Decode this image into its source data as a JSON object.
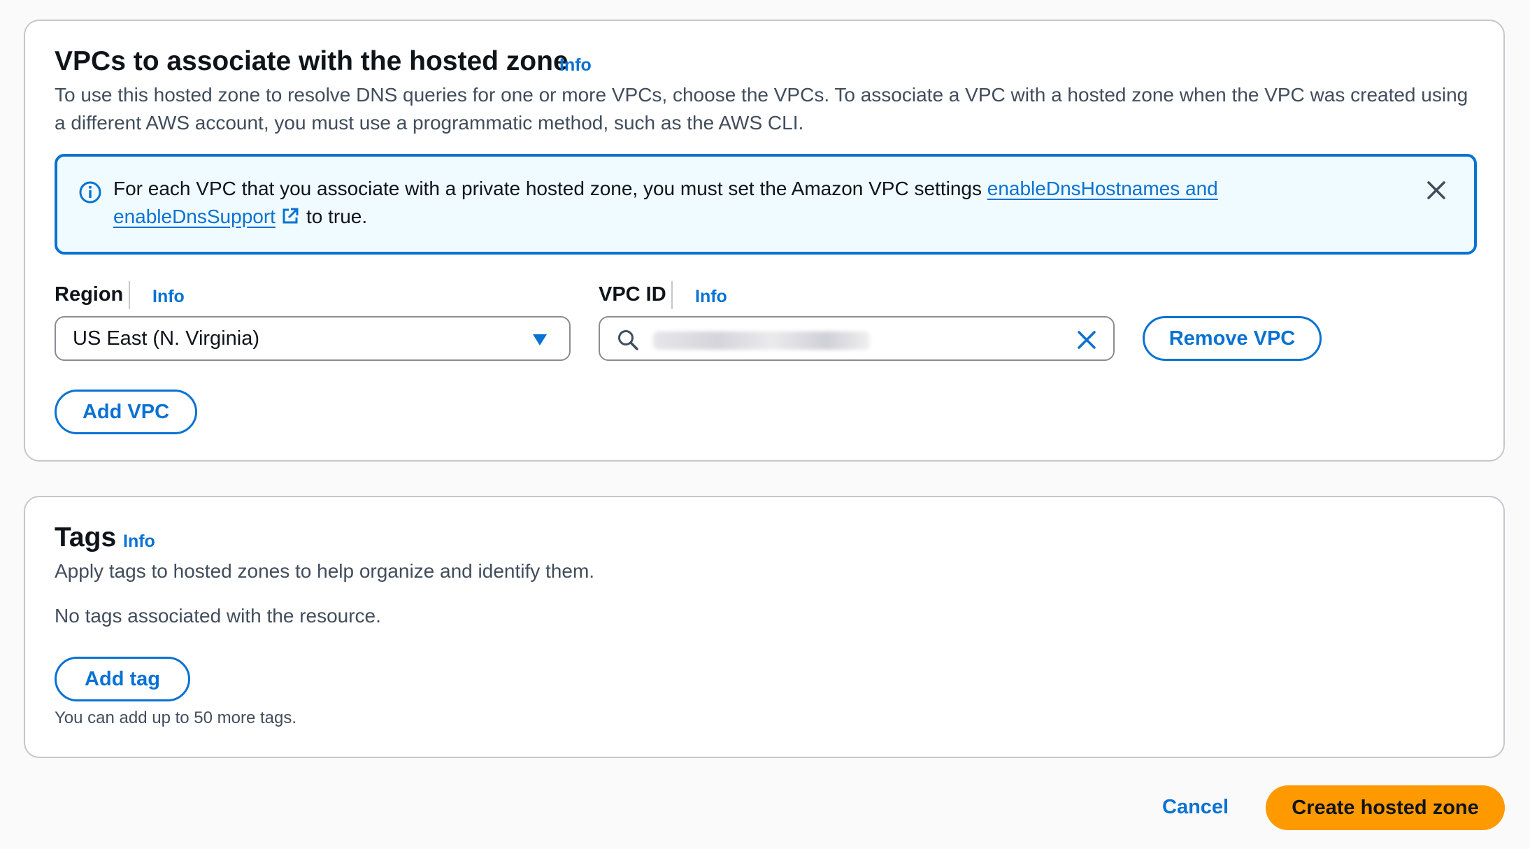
{
  "vpc_section": {
    "title": "VPCs to associate with the hosted zone",
    "info_label": "Info",
    "description": "To use this hosted zone to resolve DNS queries for one or more VPCs, choose the VPCs. To associate a VPC with a hosted zone when the VPC was created using a different AWS account, you must use a programmatic method, such as the AWS CLI.",
    "alert": {
      "text_before": "For each VPC that you associate with a private hosted zone, you must set the Amazon VPC settings ",
      "link_text": "enableDnsHostnames and enableDnsSupport",
      "text_after": "to true.",
      "icon": "info-circle-icon",
      "close_icon": "close-icon"
    },
    "region": {
      "label": "Region",
      "info_label": "Info",
      "selected": "US East (N. Virginia)"
    },
    "vpc_id": {
      "label": "VPC ID",
      "info_label": "Info",
      "value": "vpc-0123456789abcdef0"
    },
    "remove_vpc_label": "Remove VPC",
    "add_vpc_label": "Add VPC"
  },
  "tags_section": {
    "title": "Tags",
    "info_label": "Info",
    "description": "Apply tags to hosted zones to help organize and identify them.",
    "empty_text": "No tags associated with the resource.",
    "add_tag_label": "Add tag",
    "hint": "You can add up to 50 more tags."
  },
  "footer": {
    "cancel_label": "Cancel",
    "create_label": "Create hosted zone"
  },
  "colors": {
    "link": "#0972d3",
    "primary": "#ff9900",
    "alert_bg": "#f0fbff"
  }
}
